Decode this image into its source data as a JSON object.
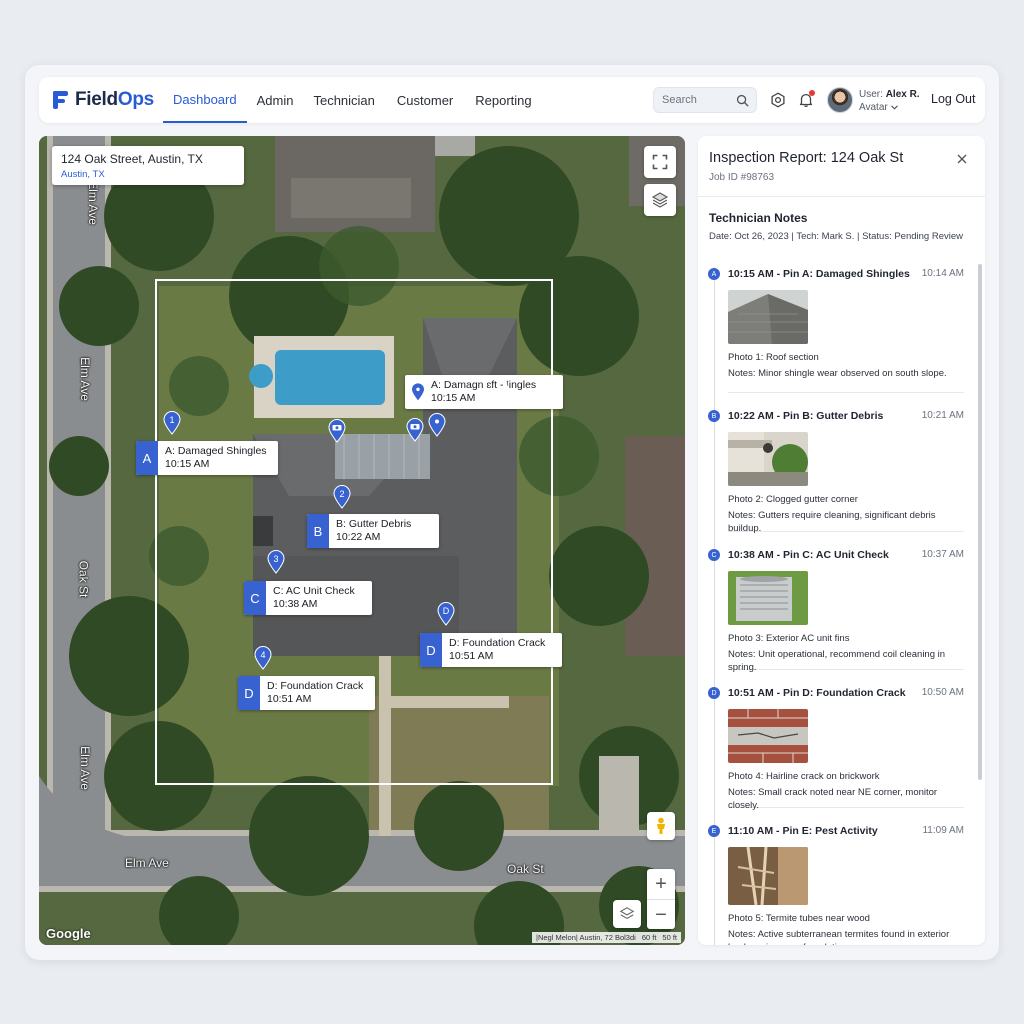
{
  "brand": {
    "name_part1": "Field",
    "name_part2": "Ops",
    "accent": "#2a5bd7"
  },
  "nav": {
    "items": [
      {
        "label": "Dashboard",
        "active": true
      },
      {
        "label": "Admin"
      },
      {
        "label": "Technician"
      },
      {
        "label": "Customer"
      },
      {
        "label": "Reporting"
      }
    ]
  },
  "header": {
    "search_placeholder": "Search",
    "user_label": "User:",
    "user_name": "Alex R.",
    "avatar_label": "Avatar",
    "logout": "Log Out",
    "icons": [
      "search-icon",
      "settings-icon",
      "bell-icon",
      "chevron-down-icon"
    ]
  },
  "map": {
    "address_title": "124 Oak Street, Austin, TX",
    "address_sub": "Austin, TX",
    "streets": [
      "Elm Ave",
      "Elm Ave",
      "Oak St",
      "Elm Ave",
      "Elm Ave",
      "Oak St"
    ],
    "attribution": "Google",
    "scale_text": "|Negl Melon| Austin, 72 Bol3di",
    "scale_dist": "60 ft",
    "scale_dist2": "50 ft",
    "labels": [
      {
        "letter": "A",
        "line1": "A: Damaged Shingles",
        "line2": "10:15 AM"
      },
      {
        "letter": "",
        "line1": "A: Damagn ɛft - ᵗingles",
        "line2": "10:15 AM"
      },
      {
        "letter": "B",
        "line1": "B: Gutter Debris",
        "line2": "10:22 AM"
      },
      {
        "letter": "C",
        "line1": "C: AC Unit Check",
        "line2": "10:38 AM"
      },
      {
        "letter": "D",
        "line1": "D: Foundation Crack",
        "line2": "10:51 AM"
      },
      {
        "letter": "D",
        "line1": "D: Foundation Crack",
        "line2": "10:51 AM"
      }
    ],
    "pins": [
      "1",
      "2",
      "3",
      "4",
      "",
      "",
      "",
      "D"
    ],
    "zoom_in": "+",
    "zoom_out": "−"
  },
  "report": {
    "title": "Inspection Report: 124 Oak St",
    "job_id": "Job ID #98763",
    "notes_heading": "Technician Notes",
    "meta": "Date: Oct 26, 2023 | Tech: Mark S. | Status: Pending Review",
    "entries": [
      {
        "dot": "A",
        "title": "10:15 AM - Pin A: Damaged Shingles",
        "time": "10:14 AM",
        "caption": "Photo 1: Roof section",
        "notes": "Notes: Minor shingle wear observed on south slope."
      },
      {
        "dot": "B",
        "title": "10:22 AM - Pin B: Gutter Debris",
        "time": "10:21 AM",
        "caption": "Photo 2: Clogged gutter corner",
        "notes": "Notes: Gutters require cleaning, significant debris buildup."
      },
      {
        "dot": "C",
        "title": "10:38 AM - Pin C: AC Unit Check",
        "time": "10:37 AM",
        "caption": "Photo 3: Exterior AC unit fins",
        "notes": "Notes: Unit operational, recommend coil cleaning in spring."
      },
      {
        "dot": "D",
        "title": "10:51 AM - Pin D: Foundation Crack",
        "time": "10:50 AM",
        "caption": "Photo 4: Hairline crack on brickwork",
        "notes": "Notes: Small crack noted near NE corner, monitor closely."
      },
      {
        "dot": "E",
        "title": "11:10 AM - Pin E: Pest Activity",
        "time": "11:09 AM",
        "caption": "Photo 5: Termite tubes near wood",
        "notes": "Notes: Active subterranean termites found in exterior landscaping near foundation."
      }
    ]
  }
}
